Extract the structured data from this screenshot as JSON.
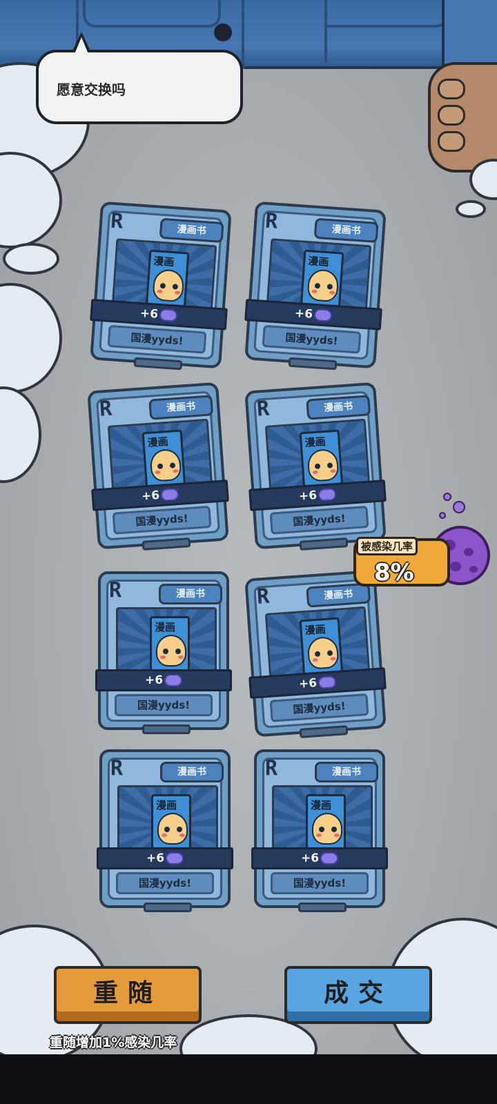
{
  "dialog": {
    "speech": "愿意交换吗"
  },
  "cards": [
    {
      "rarity": "R",
      "type": "漫画书",
      "book_title": "漫画",
      "bonus": "+6",
      "caption": "国漫yyds!"
    },
    {
      "rarity": "R",
      "type": "漫画书",
      "book_title": "漫画",
      "bonus": "+6",
      "caption": "国漫yyds!"
    },
    {
      "rarity": "R",
      "type": "漫画书",
      "book_title": "漫画",
      "bonus": "+6",
      "caption": "国漫yyds!"
    },
    {
      "rarity": "R",
      "type": "漫画书",
      "book_title": "漫画",
      "bonus": "+6",
      "caption": "国漫yyds!"
    },
    {
      "rarity": "R",
      "type": "漫画书",
      "book_title": "漫画",
      "bonus": "+6",
      "caption": "国漫yyds!"
    },
    {
      "rarity": "R",
      "type": "漫画书",
      "book_title": "漫画",
      "bonus": "+6",
      "caption": "国漫yyds!"
    },
    {
      "rarity": "R",
      "type": "漫画书",
      "book_title": "漫画",
      "bonus": "+6",
      "caption": "国漫yyds!"
    },
    {
      "rarity": "R",
      "type": "漫画书",
      "book_title": "漫画",
      "bonus": "+6",
      "caption": "国漫yyds!"
    }
  ],
  "bonus_icon": "brain-icon",
  "infection": {
    "label": "被感染几率",
    "value": "8%",
    "icon": "virus-icon",
    "color": "#8d55c9"
  },
  "buttons": {
    "reroll": "重随",
    "deal": "成交",
    "reroll_color": "#e69b3a",
    "deal_color": "#58a5e2"
  },
  "note": "重随增加1%感染几率"
}
